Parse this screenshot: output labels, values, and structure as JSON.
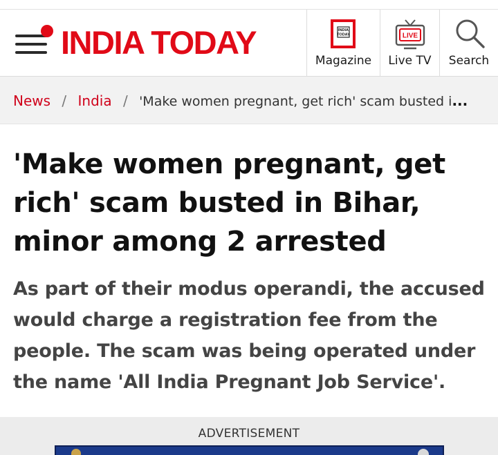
{
  "header": {
    "logo_text": "INDIA TODAY",
    "brand_color": "#e10a17",
    "nav": [
      {
        "label": "Magazine",
        "icon": "magazine-icon"
      },
      {
        "label": "Live TV",
        "icon": "live-tv-icon"
      },
      {
        "label": "Search",
        "icon": "search-icon"
      }
    ],
    "magazine_icon_text": [
      "INDIA",
      "TODAY"
    ],
    "live_badge": "LIVE"
  },
  "breadcrumb": {
    "items": [
      "News",
      "India"
    ],
    "separator": "/",
    "current": "'Make women pregnant, get rich' scam busted i",
    "ellipsis": "..."
  },
  "article": {
    "headline": "'Make women pregnant, get rich' scam busted in Bihar, minor among 2 arrested",
    "summary": "As part of their modus operandi, the accused would charge a registration fee from the people. The scam was being operated under the name 'All India Pregnant Job Service'."
  },
  "ad": {
    "label": "ADVERTISEMENT"
  }
}
